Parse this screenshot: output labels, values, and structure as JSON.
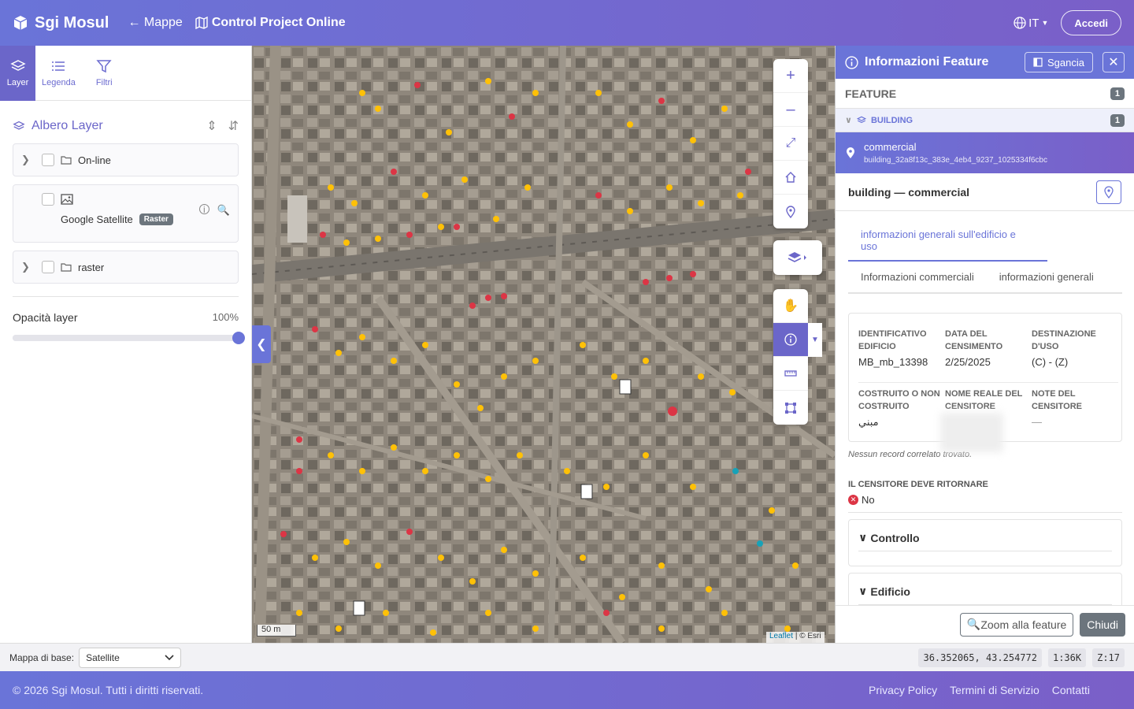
{
  "header": {
    "brand": "Sgi Mosul",
    "maps_link": "Mappe",
    "project_title": "Control Project Online",
    "language": "IT",
    "login_label": "Accedi"
  },
  "left_panel": {
    "tabs": [
      {
        "label": "Layer",
        "icon": "layers-icon",
        "active": true
      },
      {
        "label": "Legenda",
        "icon": "list-icon",
        "active": false
      },
      {
        "label": "Filtri",
        "icon": "filter-icon",
        "active": false
      }
    ],
    "tree_title": "Albero Layer",
    "nodes": [
      {
        "label": "On-line",
        "type": "folder"
      },
      {
        "label": "Google Satellite",
        "type": "raster",
        "badge": "Raster"
      },
      {
        "label": "raster",
        "type": "folder"
      }
    ],
    "opacity_label": "Opacità layer",
    "opacity_value": "100%",
    "opacity_fraction": 1.0
  },
  "map": {
    "scale_label": "50 m",
    "attribution_link": "Leaflet",
    "attribution_text": "| © Esri",
    "tools": [
      "zoom-in-icon",
      "zoom-out-icon",
      "fullscreen-icon",
      "home-icon",
      "locate-icon",
      "layers-icon",
      "pan-hand-icon",
      "info-icon",
      "ruler-icon",
      "select-area-icon"
    ],
    "active_tool": "info-icon"
  },
  "feature_panel": {
    "title": "Informazioni Feature",
    "detach_label": "Sgancia",
    "feature_header": "FEATURE",
    "feature_count": "1",
    "layer_name": "BUILDING",
    "layer_count": "1",
    "item_title": "commercial",
    "item_id": "building_32a8f13c_383e_4eb4_9237_1025334f6cbc",
    "detail_title": "building — commercial",
    "tabs": [
      "informazioni generali sull'edificio e uso",
      "Informazioni commerciali",
      "informazioni generali"
    ],
    "fields": [
      {
        "label": "IDENTIFICATIVO EDIFICIO",
        "value": "MB_mb_13398"
      },
      {
        "label": "DATA DEL CENSIMENTO",
        "value": "2/25/2025"
      },
      {
        "label": "DESTINAZIONE D'USO",
        "value": "(C) - (Z)"
      },
      {
        "label": "COSTRUITO O NON COSTRUITO",
        "value": "مبني"
      },
      {
        "label": "NOME REALE DEL CENSITORE",
        "value": ""
      },
      {
        "label": "NOTE DEL CENSITORE",
        "value": "—"
      }
    ],
    "no_records": "Nessun record correlato trovato.",
    "return_label": "IL CENSITORE DEVE RITORNARE",
    "return_value": "No",
    "sections": [
      "Controllo",
      "Edificio"
    ],
    "zoom_label": "Zoom alla feature",
    "close_label": "Chiudi"
  },
  "status_bar": {
    "basemap_label": "Mappa di base:",
    "basemap_value": "Satellite",
    "coords": "36.352065, 43.254772",
    "scale": "1:36K",
    "zoom": "Z:17"
  },
  "footer": {
    "copyright": "© 2026 Sgi Mosul. Tutti i diritti riservati.",
    "links": [
      "Privacy Policy",
      "Termini di Servizio",
      "Contatti"
    ]
  },
  "colors": {
    "accent": "#6a74d8",
    "accent2": "#7a5fc8"
  }
}
